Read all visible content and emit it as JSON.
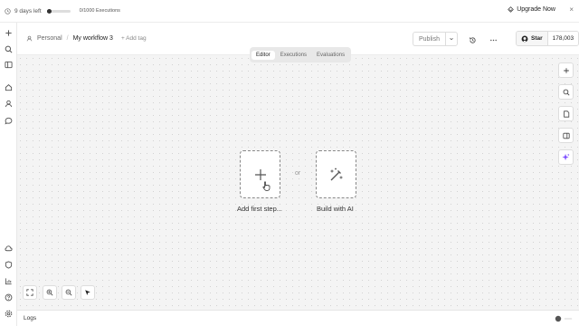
{
  "topbar": {
    "trial_text": "9 days left",
    "trial_progress": 0.1,
    "executions_text": "0/1000 Executions",
    "upgrade_label": "Upgrade Now"
  },
  "header": {
    "breadcrumb_owner": "Personal",
    "breadcrumb_separator": "/",
    "workflow_name": "My workflow 3",
    "add_tag_label": "+ Add tag",
    "publish_label": "Publish",
    "star_label": "Star",
    "star_count": "178,003"
  },
  "tabs": [
    {
      "label": "Editor",
      "active": true
    },
    {
      "label": "Executions",
      "active": false
    },
    {
      "label": "Evaluations",
      "active": false
    }
  ],
  "canvas": {
    "add_first_step_label": "Add first step...",
    "or_label": "or",
    "build_with_ai_label": "Build with AI"
  },
  "logs": {
    "label": "Logs"
  },
  "colors": {
    "accent_ai": "#7c4dff",
    "text_dark": "#222222"
  },
  "icons": {
    "sidebar_top": [
      "plus-icon",
      "search-icon",
      "panel-toggle-icon",
      "home-icon",
      "user-icon",
      "chat-icon"
    ],
    "sidebar_bottom": [
      "cloud-icon",
      "shield-icon",
      "chart-icon",
      "help-icon",
      "settings-icon"
    ],
    "right_tools": [
      "plus-icon",
      "search-icon",
      "note-icon",
      "panel-icon",
      "sparkle-icon"
    ],
    "bottom_tools": [
      "fit-view-icon",
      "zoom-in-icon",
      "zoom-out-icon",
      "pointer-icon"
    ]
  }
}
